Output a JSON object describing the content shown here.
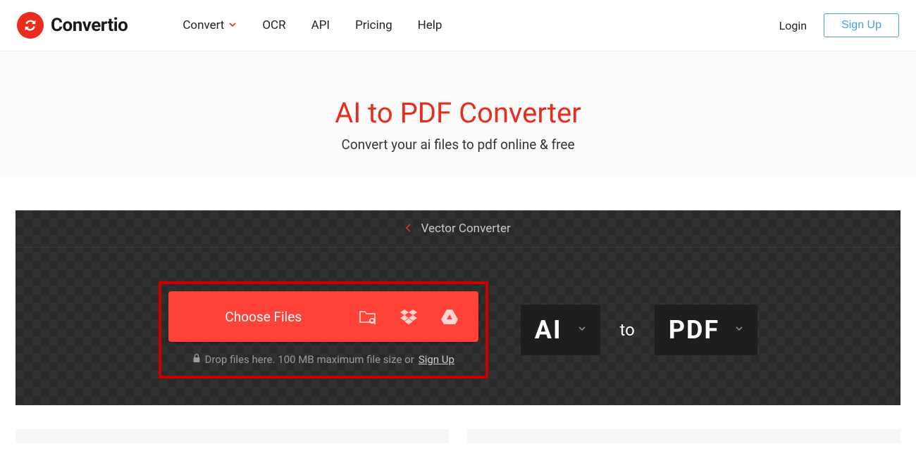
{
  "brand": "Convertio",
  "nav": {
    "convert": "Convert",
    "ocr": "OCR",
    "api": "API",
    "pricing": "Pricing",
    "help": "Help"
  },
  "auth": {
    "login": "Login",
    "signup": "Sign Up"
  },
  "hero": {
    "title": "AI to PDF Converter",
    "subtitle": "Convert your ai files to pdf online & free"
  },
  "breadcrumb": {
    "label": "Vector Converter"
  },
  "uploader": {
    "choose_label": "Choose Files",
    "hint_prefix": "Drop files here. 100 MB maximum file size or ",
    "hint_link": "Sign Up"
  },
  "formats": {
    "from": "AI",
    "to_word": "to",
    "to": "PDF"
  }
}
